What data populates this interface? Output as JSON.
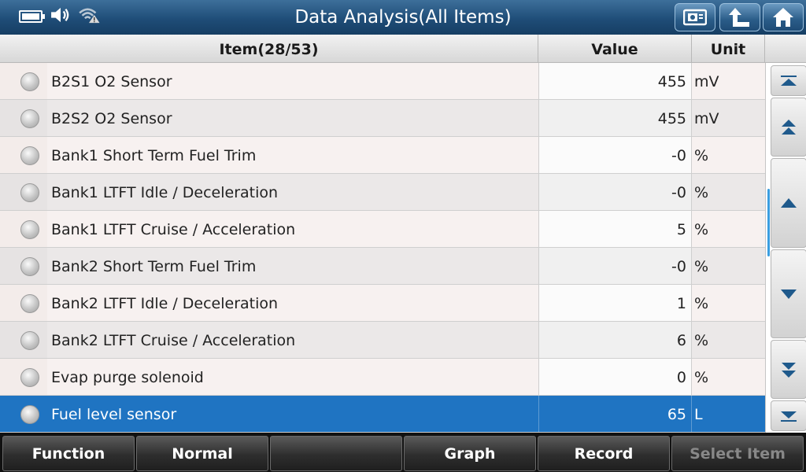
{
  "header": {
    "title": "Data Analysis(All Items)",
    "icons": [
      "battery-charging-icon",
      "speaker-icon",
      "wifi-warning-icon",
      "screenshot-icon",
      "back-up-icon",
      "home-icon"
    ]
  },
  "table": {
    "columns": {
      "item": "Item(28/53)",
      "value": "Value",
      "unit": "Unit"
    },
    "rows": [
      {
        "name": "B2S1 O2 Sensor",
        "value": "455",
        "unit": "mV"
      },
      {
        "name": "B2S2 O2 Sensor",
        "value": "455",
        "unit": "mV"
      },
      {
        "name": "Bank1 Short Term Fuel Trim",
        "value": "-0",
        "unit": "%"
      },
      {
        "name": "Bank1 LTFT Idle / Deceleration",
        "value": "-0",
        "unit": "%"
      },
      {
        "name": "Bank1 LTFT Cruise / Acceleration",
        "value": "5",
        "unit": "%"
      },
      {
        "name": "Bank2 Short Term Fuel Trim",
        "value": "-0",
        "unit": "%"
      },
      {
        "name": "Bank2 LTFT Idle / Deceleration",
        "value": "1",
        "unit": "%"
      },
      {
        "name": "Bank2 LTFT Cruise / Acceleration",
        "value": "6",
        "unit": "%"
      },
      {
        "name": "Evap purge solenoid",
        "value": "0",
        "unit": "%"
      },
      {
        "name": "Fuel level sensor",
        "value": "65",
        "unit": "L"
      }
    ],
    "selected_index": 9
  },
  "scroll": {
    "buttons": [
      "scroll-top",
      "page-up",
      "line-up",
      "line-down",
      "page-down",
      "scroll-bottom"
    ]
  },
  "footer": {
    "buttons": [
      {
        "label": "Function",
        "enabled": true
      },
      {
        "label": "Normal",
        "enabled": true
      },
      {
        "label": "",
        "enabled": true
      },
      {
        "label": "Graph",
        "enabled": true
      },
      {
        "label": "Record",
        "enabled": true
      },
      {
        "label": "Select Item",
        "enabled": false
      }
    ]
  },
  "colors": {
    "titlebar": "#1f4d78",
    "selected_row": "#1f74c2",
    "scroll_indicator": "#3a9ee0"
  }
}
